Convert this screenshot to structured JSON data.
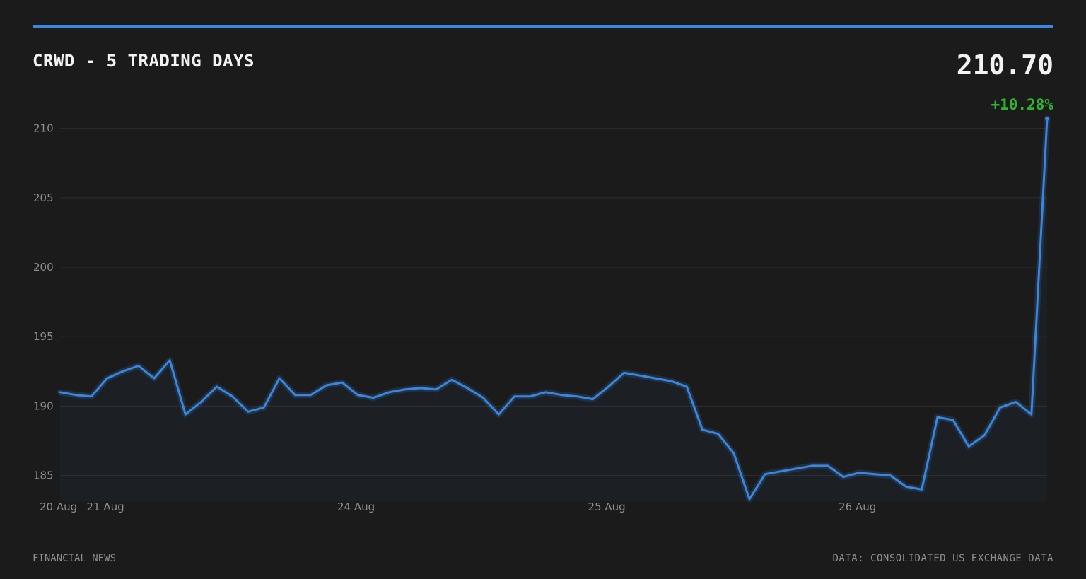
{
  "header": {
    "title": "CRWD - 5 TRADING DAYS",
    "price": "210.70",
    "change": "+10.28%"
  },
  "footer": {
    "source_left": "FINANCIAL NEWS",
    "source_right": "DATA: CONSOLIDATED US EXCHANGE DATA"
  },
  "colors": {
    "background": "#1b1b1b",
    "accent": "#3a86e0",
    "positive": "#2fb52f",
    "grid": "#2e2e2e",
    "tick_text": "#8f8f8f"
  },
  "chart_data": {
    "type": "line",
    "title": "CRWD - 5 TRADING DAYS",
    "xlabel": "",
    "ylabel": "",
    "ylim": [
      183.2,
      211.2
    ],
    "yticks": [
      185,
      190,
      195,
      200,
      205,
      210
    ],
    "grid": true,
    "legend": "none",
    "x_tick_labels": [
      {
        "label": "20 Aug",
        "index": 0
      },
      {
        "label": "21 Aug",
        "index": 3
      },
      {
        "label": "24 Aug",
        "index": 19
      },
      {
        "label": "25 Aug",
        "index": 35
      },
      {
        "label": "26 Aug",
        "index": 51
      }
    ],
    "series": [
      {
        "values": [
          191.0,
          190.8,
          190.7,
          192.0,
          192.5,
          192.9,
          192.0,
          193.3,
          189.4,
          190.3,
          191.4,
          190.7,
          189.6,
          189.9,
          192.0,
          190.8,
          190.8,
          191.5,
          191.7,
          190.8,
          190.6,
          191.0,
          191.2,
          191.3,
          191.2,
          191.9,
          191.3,
          190.6,
          189.4,
          190.7,
          190.7,
          191.0,
          190.8,
          190.7,
          190.5,
          191.4,
          192.4,
          192.2,
          192.0,
          191.8,
          191.4,
          188.3,
          188.0,
          186.6,
          183.3,
          185.1,
          185.3,
          185.5,
          185.7,
          185.7,
          184.9,
          185.2,
          185.1,
          185.0,
          184.2,
          184.0,
          189.2,
          189.0,
          187.1,
          187.9,
          189.9,
          190.3,
          189.4,
          210.7
        ]
      }
    ]
  }
}
